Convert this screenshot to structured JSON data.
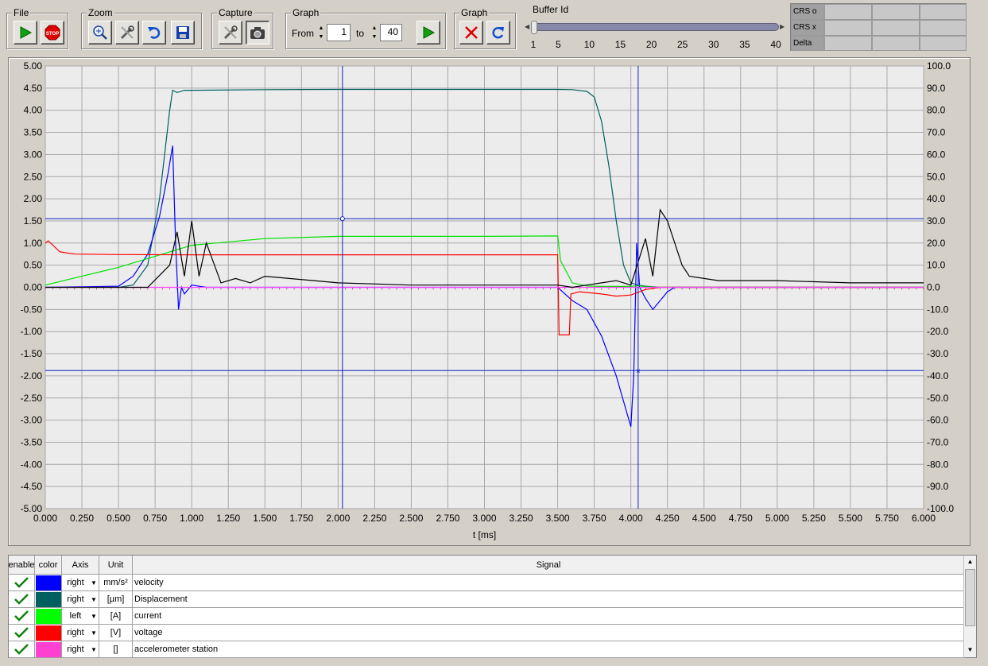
{
  "toolbar": {
    "file": {
      "title": "File"
    },
    "zoom": {
      "title": "Zoom"
    },
    "capture": {
      "title": "Capture"
    },
    "graph_range": {
      "title": "Graph",
      "from_label": "From",
      "from_value": "1",
      "to_label": "to",
      "to_value": "40"
    },
    "graph_actions": {
      "title": "Graph"
    },
    "buffer": {
      "title": "Buffer Id",
      "ticks": [
        "1",
        "5",
        "10",
        "15",
        "20",
        "25",
        "30",
        "35",
        "40"
      ],
      "value": 1,
      "min": 1,
      "max": 40
    }
  },
  "cursor_table": {
    "rows": [
      "CRS  o",
      "CRS  x",
      "Delta"
    ]
  },
  "icons": {
    "run": "play-icon",
    "stop": "stop-icon",
    "zoom_in": "magnifier-plus-icon",
    "zoom_tools": "tools-icon",
    "undo": "undo-icon",
    "save": "floppy-disk-icon",
    "capture_tools": "tools-icon",
    "camera": "camera-icon",
    "graph_run": "play-icon",
    "clear": "red-x-icon",
    "refresh": "refresh-icon"
  },
  "chart_data": {
    "type": "line",
    "xlabel": "t [ms]",
    "xlim": [
      0,
      6
    ],
    "ylim_left": [
      -5,
      5
    ],
    "ylim_right": [
      -100,
      100
    ],
    "grid": true,
    "x_ticks": [
      "0.000",
      "0.250",
      "0.500",
      "0.750",
      "1.000",
      "1.250",
      "1.500",
      "1.750",
      "2.000",
      "2.250",
      "2.500",
      "2.750",
      "3.000",
      "3.250",
      "3.500",
      "3.750",
      "4.000",
      "4.250",
      "4.500",
      "4.750",
      "5.000",
      "5.250",
      "5.500",
      "5.750",
      "6.000"
    ],
    "y_left_ticks": [
      "5.00",
      "4.50",
      "4.00",
      "3.50",
      "3.00",
      "2.50",
      "2.00",
      "1.50",
      "1.00",
      "0.50",
      "0.00",
      "-0.50",
      "-1.00",
      "-1.50",
      "-2.00",
      "-2.50",
      "-3.00",
      "-3.50",
      "-4.00",
      "-4.50",
      "-5.00"
    ],
    "y_right_ticks": [
      "100.0",
      "90.0",
      "80.0",
      "70.0",
      "60.0",
      "50.0",
      "40.0",
      "30.0",
      "20.0",
      "10.0",
      "0.0",
      "-10.0",
      "-20.0",
      "-30.0",
      "-40.0",
      "-50.0",
      "-60.0",
      "-70.0",
      "-80.0",
      "-90.0",
      "-100.0"
    ],
    "cursors": {
      "o": {
        "x": 2.03,
        "y": 1.55
      },
      "x": {
        "x": 4.05,
        "y": -1.88
      }
    },
    "series": [
      {
        "name": "Displacement",
        "axis": "right",
        "color": "#006060",
        "x": [
          0,
          0.5,
          0.6,
          0.7,
          0.78,
          0.85,
          0.87,
          0.9,
          0.95,
          1.0,
          1.5,
          2.0,
          3.0,
          3.5,
          3.6,
          3.7,
          3.75,
          3.8,
          3.85,
          3.9,
          3.95,
          4.0,
          4.05,
          4.1,
          4.2,
          4.3,
          6.0
        ],
        "y": [
          0,
          0,
          1,
          10,
          40,
          80,
          89,
          88,
          89,
          89,
          89.3,
          89.4,
          89.4,
          89.4,
          89.3,
          88.5,
          86,
          75,
          55,
          30,
          10,
          2,
          1,
          0.5,
          0,
          0,
          0
        ]
      },
      {
        "name": "velocity",
        "axis": "right",
        "color": "#0000ff",
        "x": [
          0,
          0.5,
          0.6,
          0.7,
          0.78,
          0.84,
          0.87,
          0.89,
          0.91,
          0.93,
          0.95,
          1.0,
          1.1,
          1.5,
          2.0,
          3.0,
          3.5,
          3.6,
          3.7,
          3.8,
          3.9,
          4.0,
          4.02,
          4.04,
          4.06,
          4.1,
          4.15,
          4.2,
          4.25,
          4.3,
          4.4,
          6.0
        ],
        "y": [
          0,
          0.5,
          5,
          15,
          32,
          52,
          64,
          20,
          -10,
          0,
          -3,
          1,
          0,
          0,
          0,
          0,
          0,
          -6,
          -10,
          -22,
          -40,
          -63,
          -40,
          20,
          0,
          -5,
          -10,
          -6,
          -2,
          0,
          0,
          0
        ]
      },
      {
        "name": "current",
        "axis": "left",
        "color": "#00e000",
        "x": [
          0,
          0.5,
          1.0,
          1.5,
          2.0,
          2.5,
          3.0,
          3.5,
          3.52,
          3.6,
          3.7,
          3.8,
          3.9,
          4.0,
          4.05,
          4.1,
          4.2,
          6.0
        ],
        "y": [
          0.05,
          0.45,
          0.95,
          1.1,
          1.15,
          1.15,
          1.15,
          1.16,
          0.6,
          0.1,
          0.03,
          0.02,
          0.02,
          0.02,
          0.04,
          0.01,
          0,
          0
        ]
      },
      {
        "name": "voltage",
        "axis": "right",
        "color": "#ff0000",
        "x": [
          0,
          0.02,
          0.1,
          0.2,
          0.5,
          1.0,
          2.0,
          3.0,
          3.5,
          3.51,
          3.58,
          3.59,
          3.65,
          3.8,
          3.9,
          4.0,
          4.1,
          4.2,
          4.3,
          4.4,
          6.0
        ],
        "y": [
          20,
          21,
          16,
          15,
          14.8,
          14.7,
          14.7,
          14.7,
          14.7,
          -21.5,
          -21.5,
          -3,
          -2,
          -3,
          -4,
          -3.5,
          -1,
          0,
          0,
          0,
          0
        ]
      },
      {
        "name": "accelerometer station",
        "axis": "right",
        "color": "#ff40ff",
        "x": [
          0,
          6.0
        ],
        "y": [
          0,
          0
        ]
      },
      {
        "name": "unlisted black trace",
        "axis": "right",
        "color": "#000000",
        "x": [
          0,
          0.7,
          0.85,
          0.9,
          0.95,
          1.0,
          1.05,
          1.1,
          1.2,
          1.3,
          1.4,
          1.5,
          2.0,
          2.5,
          3.0,
          3.5,
          3.6,
          3.7,
          3.8,
          3.9,
          4.0,
          4.1,
          4.15,
          4.2,
          4.25,
          4.3,
          4.35,
          4.4,
          4.6,
          5.0,
          5.5,
          6.0
        ],
        "y": [
          0,
          0,
          10,
          25,
          5,
          30,
          5,
          20,
          2,
          4,
          2,
          5,
          2,
          1,
          1,
          1,
          0,
          1,
          2,
          3,
          1,
          22,
          5,
          35,
          30,
          20,
          10,
          5,
          3,
          3,
          2,
          2
        ]
      }
    ]
  },
  "signal_table": {
    "headers": {
      "enable": "enable",
      "color": "color",
      "axis": "Axis",
      "unit": "Unit",
      "signal": "Signal"
    },
    "rows": [
      {
        "enabled": true,
        "color": "#0000ff",
        "axis": "right",
        "unit": "mm/s²",
        "signal": "velocity"
      },
      {
        "enabled": true,
        "color": "#006060",
        "axis": "right",
        "unit": "[µm]",
        "signal": "Displacement"
      },
      {
        "enabled": true,
        "color": "#00ff00",
        "axis": "left",
        "unit": "[A]",
        "signal": "current"
      },
      {
        "enabled": true,
        "color": "#ff0000",
        "axis": "right",
        "unit": "[V]",
        "signal": "voltage"
      },
      {
        "enabled": true,
        "color": "#ff40d0",
        "axis": "right",
        "unit": "[]",
        "signal": "accelerometer station"
      }
    ]
  }
}
